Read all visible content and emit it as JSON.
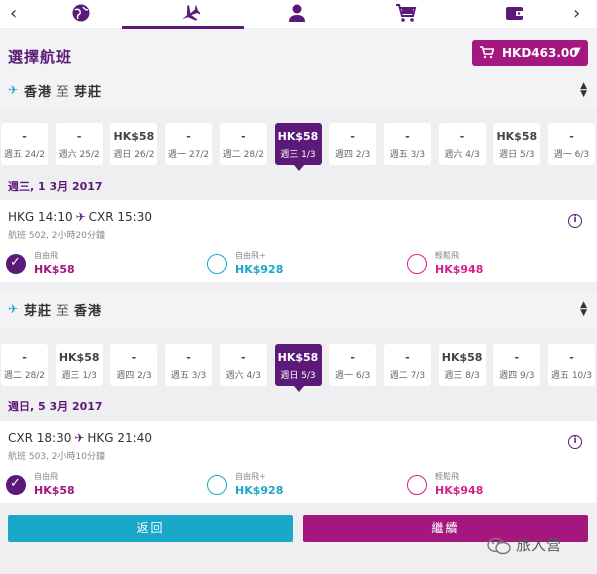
{
  "nav": {
    "prev": "‹",
    "next": "›",
    "icons": [
      "globe-icon",
      "flight-icon",
      "person-icon",
      "cart-icon",
      "wallet-icon"
    ]
  },
  "header": {
    "title": "選擇航班",
    "total_price": "HKD463.00"
  },
  "outbound": {
    "from": "香港",
    "to_word": "至",
    "to": "芽莊",
    "dates": [
      {
        "price": "-",
        "date": "週五 24/2"
      },
      {
        "price": "-",
        "date": "週六 25/2"
      },
      {
        "price": "HK$58",
        "date": "週日 26/2"
      },
      {
        "price": "-",
        "date": "週一 27/2"
      },
      {
        "price": "-",
        "date": "週二 28/2"
      },
      {
        "price": "HK$58",
        "date": "週三 1/3",
        "selected": true
      },
      {
        "price": "-",
        "date": "週四 2/3"
      },
      {
        "price": "-",
        "date": "週五 3/3"
      },
      {
        "price": "-",
        "date": "週六 4/3"
      },
      {
        "price": "HK$58",
        "date": "週日 5/3"
      },
      {
        "price": "-",
        "date": "週一 6/3"
      }
    ],
    "selected_date": "週三, 1 3月 2017",
    "flight": {
      "dep": "HKG 14:10",
      "arr": "CXR 15:30",
      "info": "航班 502, 2小時20分鐘",
      "fares": [
        {
          "name": "自由飛",
          "price": "HK$58",
          "color": "#5b1a78"
        },
        {
          "name": "自由飛+",
          "price": "HK$928",
          "color": "#1ba7c9"
        },
        {
          "name": "輕鬆飛",
          "price": "HK$948",
          "color": "#d61f8a"
        }
      ]
    }
  },
  "inbound": {
    "from": "芽莊",
    "to_word": "至",
    "to": "香港",
    "dates": [
      {
        "price": "-",
        "date": "週二 28/2"
      },
      {
        "price": "HK$58",
        "date": "週三 1/3"
      },
      {
        "price": "-",
        "date": "週四 2/3"
      },
      {
        "price": "-",
        "date": "週五 3/3"
      },
      {
        "price": "-",
        "date": "週六 4/3"
      },
      {
        "price": "HK$58",
        "date": "週日 5/3",
        "selected": true
      },
      {
        "price": "-",
        "date": "週一 6/3"
      },
      {
        "price": "-",
        "date": "週二 7/3"
      },
      {
        "price": "HK$58",
        "date": "週三 8/3"
      },
      {
        "price": "-",
        "date": "週四 9/3"
      },
      {
        "price": "-",
        "date": "週五 10/3"
      }
    ],
    "selected_date": "週日, 5 3月 2017",
    "flight": {
      "dep": "CXR 18:30",
      "arr": "HKG 21:40",
      "info": "航班 503, 2小時10分鐘",
      "fares": [
        {
          "name": "自由飛",
          "price": "HK$58",
          "color": "#5b1a78"
        },
        {
          "name": "自由飛+",
          "price": "HK$928",
          "color": "#1ba7c9"
        },
        {
          "name": "輕鬆飛",
          "price": "HK$948",
          "color": "#d61f8a"
        }
      ]
    }
  },
  "footer": {
    "back_label": "返回",
    "continue_label": "繼續",
    "watermark": "旅人营"
  },
  "colors": {
    "brand_purple": "#5b1a78",
    "brand_magenta": "#a3177e",
    "cyan": "#1ba7c9",
    "pink": "#d61f8a"
  }
}
